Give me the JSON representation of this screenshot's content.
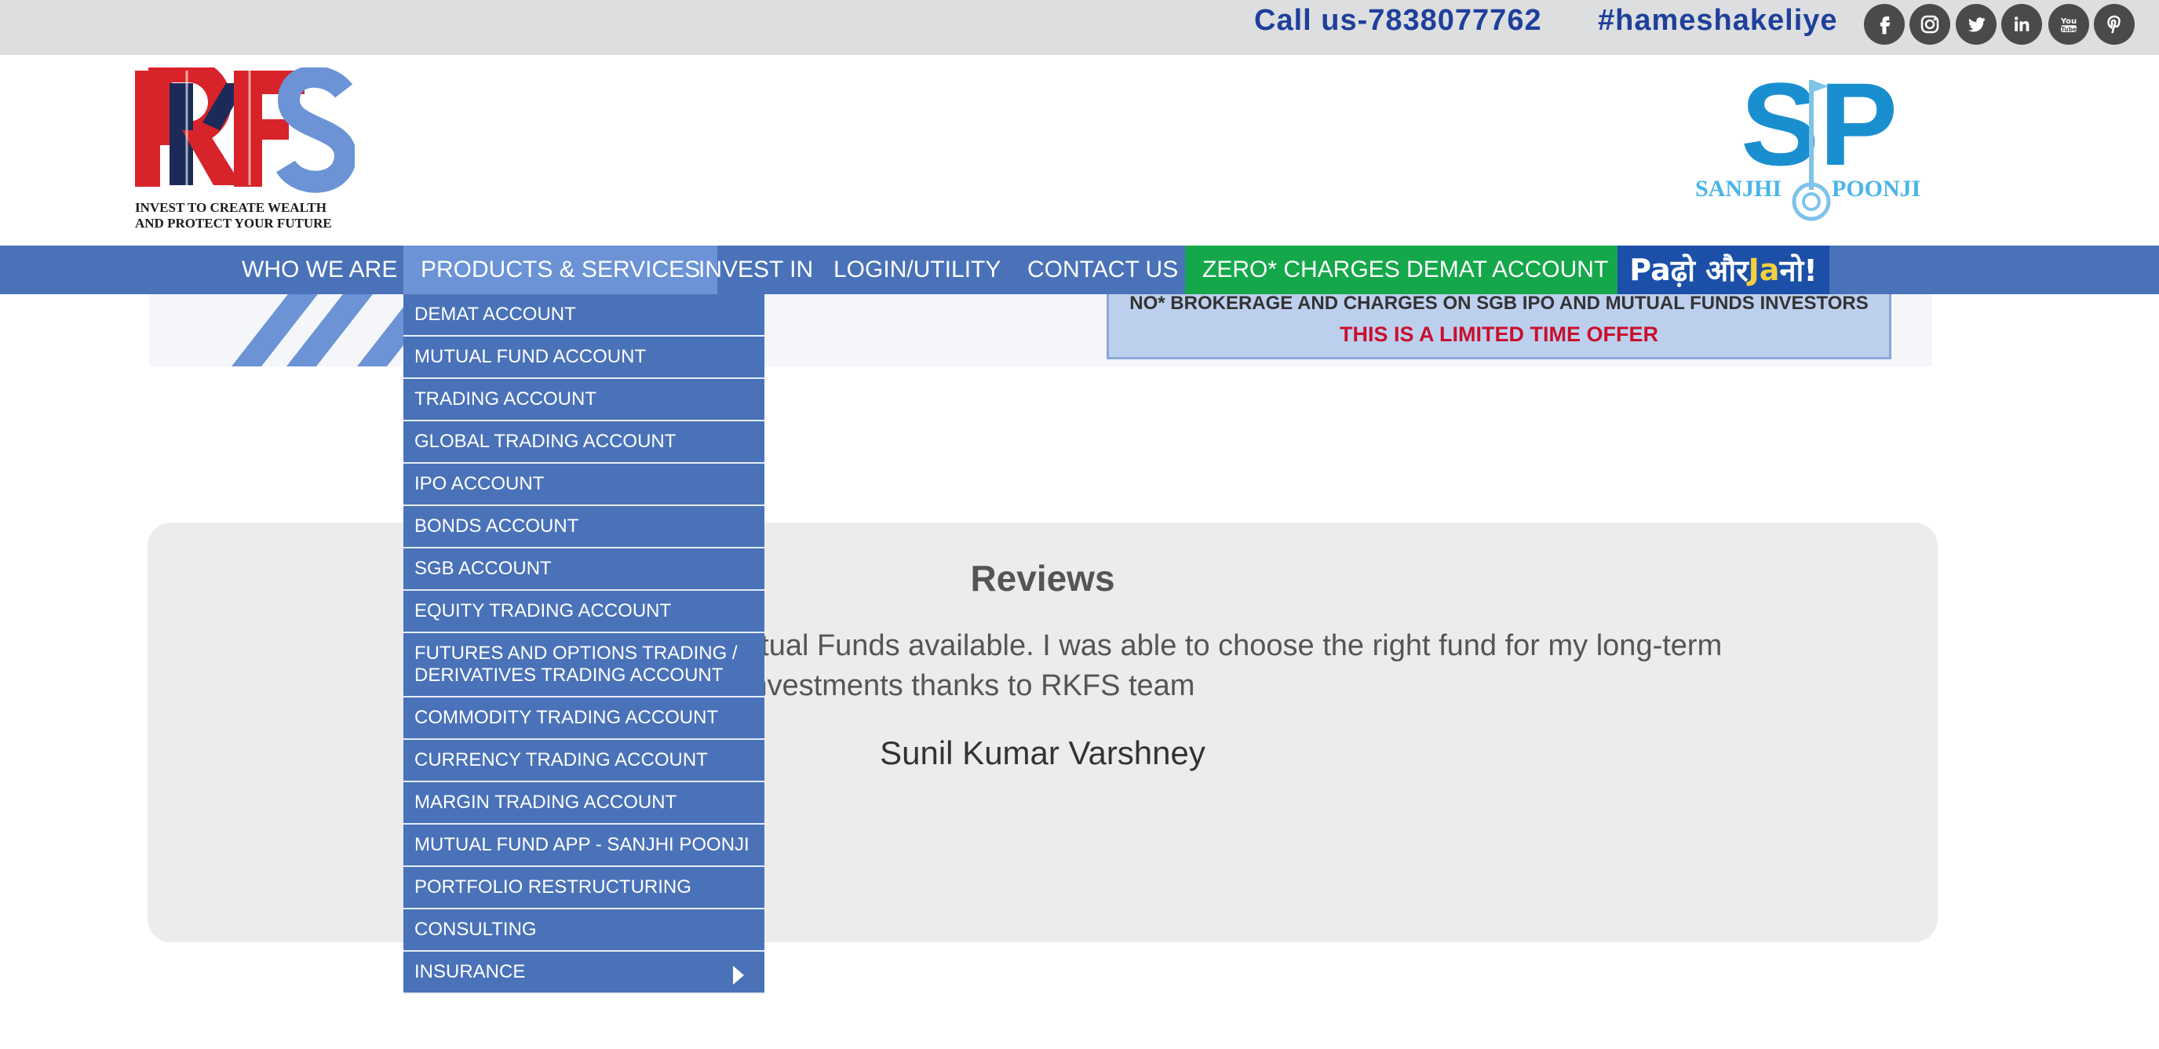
{
  "topbar": {
    "call": "Call us-7838077762",
    "hashtag": "#hameshakeliye",
    "social_icons": [
      "facebook-icon",
      "instagram-icon",
      "twitter-icon",
      "linkedin-icon",
      "youtube-icon",
      "pinterest-icon"
    ]
  },
  "header": {
    "logo_text": "RKFS",
    "logo_tagline_1": "INVEST TO CREATE WEALTH",
    "logo_tagline_2": "AND PROTECT YOUR FUTURE",
    "sp_logo_letters": "SP",
    "sp_logo_left": "SANJHI",
    "sp_logo_right": "POONJI"
  },
  "nav": {
    "items": [
      "WHO WE ARE",
      "PRODUCTS & SERVICES",
      "INVEST IN",
      "LOGIN/UTILITY",
      "CONTACT US",
      "ZERO* CHARGES DEMAT ACCOUNT"
    ],
    "active": "PRODUCTS & SERVICES",
    "badge_pa": "Pa",
    "badge_dho_aur": "ढ़ो और",
    "badge_ja": "Ja",
    "badge_no": "नो!"
  },
  "banner": {
    "line1": "NO* BROKERAGE AND CHARGES ON SGB IPO AND MUTUAL FUNDS INVESTORS",
    "line2": "THIS IS A LIMITED TIME OFFER"
  },
  "dropdown": {
    "items": [
      "DEMAT ACCOUNT",
      "MUTUAL FUND ACCOUNT",
      "TRADING ACCOUNT",
      "GLOBAL TRADING ACCOUNT",
      "IPO ACCOUNT",
      "BONDS ACCOUNT",
      "SGB ACCOUNT",
      "EQUITY TRADING ACCOUNT",
      "FUTURES AND OPTIONS TRADING / DERIVATIVES TRADING ACCOUNT",
      "COMMODITY TRADING ACCOUNT",
      "CURRENCY TRADING ACCOUNT",
      "MARGIN TRADING ACCOUNT",
      "MUTUAL FUND APP - SANJHI POONJI",
      "PORTFOLIO RESTRUCTURING",
      "CONSULTING",
      "INSURANCE"
    ]
  },
  "reviews": {
    "title": "Reviews",
    "quote": "utual Funds available. I was able to choose the right fund for my long-term investments thanks to RKFS team",
    "author": "Sunil Kumar Varshney"
  },
  "colors": {
    "nav_blue": "#4a72b8",
    "nav_active": "#6b93d6",
    "zero_charges_green": "#14a84a",
    "call_blue": "#1f3f9a",
    "offer_red": "#c8102e"
  }
}
